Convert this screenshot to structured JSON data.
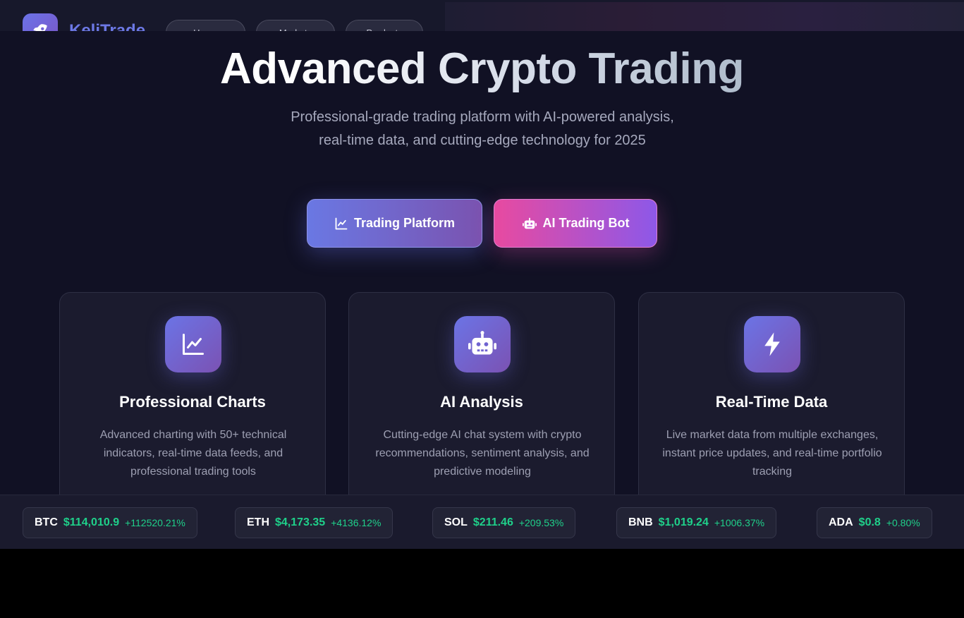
{
  "header": {
    "brand": "KeliTrade",
    "nav": [
      "Home",
      "Markets",
      "Products"
    ]
  },
  "hero": {
    "title": "Advanced Crypto Trading",
    "subtitle": "Professional-grade trading platform with AI-powered analysis, real-time data, and cutting-edge technology for 2025",
    "buttons": {
      "platform_label": "Trading Platform",
      "bot_label": "AI Trading Bot"
    }
  },
  "features": [
    {
      "title": "Professional Charts",
      "description": "Advanced charting with 50+ technical indicators, real-time data feeds, and professional trading tools",
      "icon": "chart-line-icon"
    },
    {
      "title": "AI Analysis",
      "description": "Cutting-edge AI chat system with crypto recommendations, sentiment analysis, and predictive modeling",
      "icon": "robot-icon"
    },
    {
      "title": "Real-Time Data",
      "description": "Live market data from multiple exchanges, instant price updates, and real-time portfolio tracking",
      "icon": "lightning-icon"
    }
  ],
  "ticker": [
    {
      "symbol": "BTC",
      "price": "$114,010.9",
      "change": "+112520.21%"
    },
    {
      "symbol": "ETH",
      "price": "$4,173.35",
      "change": "+4136.12%"
    },
    {
      "symbol": "SOL",
      "price": "$211.46",
      "change": "+209.53%"
    },
    {
      "symbol": "BNB",
      "price": "$1,019.24",
      "change": "+1006.37%"
    },
    {
      "symbol": "ADA",
      "price": "$0.8",
      "change": "+0.80%"
    }
  ],
  "colors": {
    "background": "#111124",
    "accent_blue": "#6a78e3",
    "accent_pink": "#e84aa0",
    "positive": "#1fd08a"
  }
}
